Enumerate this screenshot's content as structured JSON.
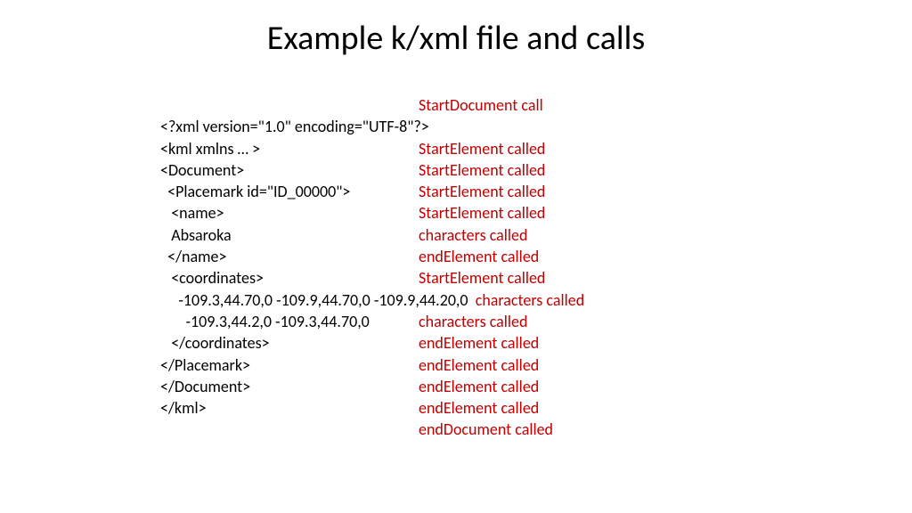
{
  "title": "Example k/xml file and calls",
  "rows": [
    {
      "left": "",
      "right": "StartDocument call"
    },
    {
      "left": "<?xml version=\"1.0\" encoding=\"UTF-8\"?>",
      "right": ""
    },
    {
      "left": "<kml xmlns … >",
      "right": "StartElement called"
    },
    {
      "left": "<Document>",
      "right": "StartElement called"
    },
    {
      "left": "  <Placemark id=\"ID_00000\">",
      "right": "StartElement called"
    },
    {
      "left": "   <name>",
      "right": "StartElement called"
    },
    {
      "left": "   Absaroka",
      "right": "characters called"
    },
    {
      "left": "  </name>",
      "right": "endElement called"
    },
    {
      "left": "   <coordinates>",
      "right": "StartElement called"
    },
    {
      "left": "     -109.3,44.70,0 -109.9,44.70,0 -109.9,44.20,0  ",
      "right": "characters called",
      "inline": true
    },
    {
      "left": "       -109.3,44.2,0 -109.3,44.70,0",
      "right": "characters called"
    },
    {
      "left": "   </coordinates>",
      "right": "endElement called"
    },
    {
      "left": "</Placemark>",
      "right": "endElement called"
    },
    {
      "left": "</Document>",
      "right": "endElement called"
    },
    {
      "left": "</kml>",
      "right": "endElement called"
    },
    {
      "left": "",
      "right": "endDocument called"
    }
  ]
}
